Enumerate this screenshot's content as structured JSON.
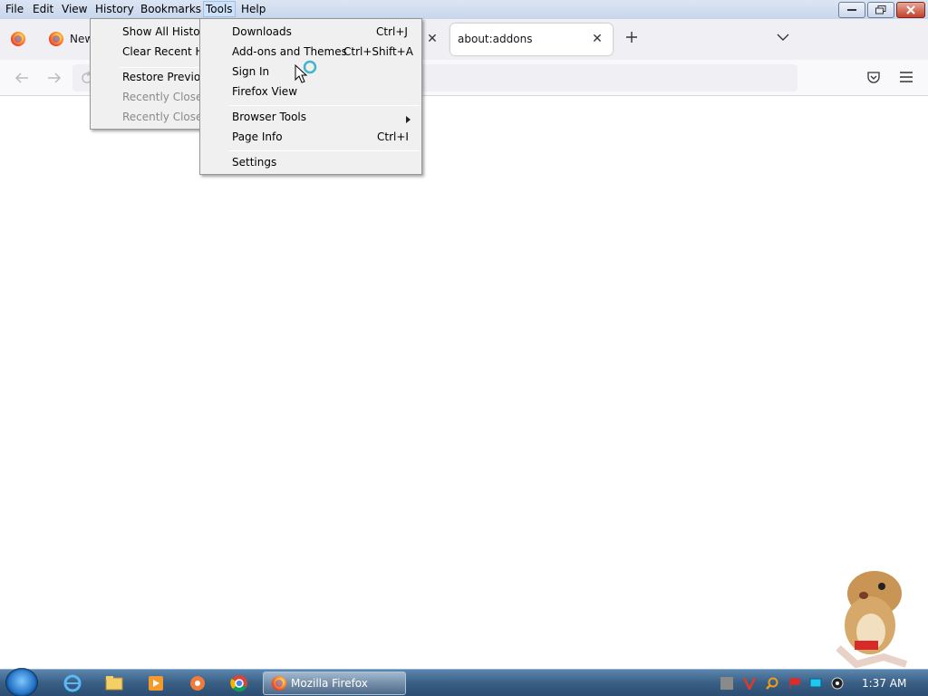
{
  "menubar": {
    "items": [
      "File",
      "Edit",
      "View",
      "History",
      "Bookmarks",
      "Tools",
      "Help"
    ]
  },
  "tabs": [
    {
      "label": "New"
    },
    {
      "label": "about:addons"
    }
  ],
  "history_menu": {
    "items": [
      "Show All History",
      "Clear Recent His",
      "Restore Previous",
      "Recently Closed",
      "Recently Closed"
    ]
  },
  "tools_menu": {
    "items": [
      {
        "label": "Downloads",
        "shortcut": "Ctrl+J"
      },
      {
        "label": "Add-ons and Themes",
        "shortcut": "Ctrl+Shift+A"
      },
      {
        "label": "Sign In",
        "shortcut": ""
      },
      {
        "label": "Firefox View",
        "shortcut": ""
      },
      {
        "label": "Browser Tools",
        "shortcut": ""
      },
      {
        "label": "Page Info",
        "shortcut": "Ctrl+I"
      },
      {
        "label": "Settings",
        "shortcut": ""
      }
    ]
  },
  "taskbar": {
    "firefox_label": "Mozilla Firefox",
    "clock": "1:37 AM"
  },
  "colors": {
    "tabstrip": "#f0f0f4",
    "taskbar": "#3a5f85",
    "menu_bg": "#f0f0f0"
  },
  "icons": [
    "firefox-icon",
    "back-arrow-icon",
    "forward-arrow-icon",
    "reload-icon",
    "pocket-icon",
    "hamburger-menu-icon",
    "plus-icon",
    "chevron-down-icon",
    "close-icon",
    "start-orb-icon",
    "internet-explorer-icon",
    "folder-icon",
    "media-player-icon",
    "app-icon",
    "chrome-icon",
    "clock"
  ]
}
